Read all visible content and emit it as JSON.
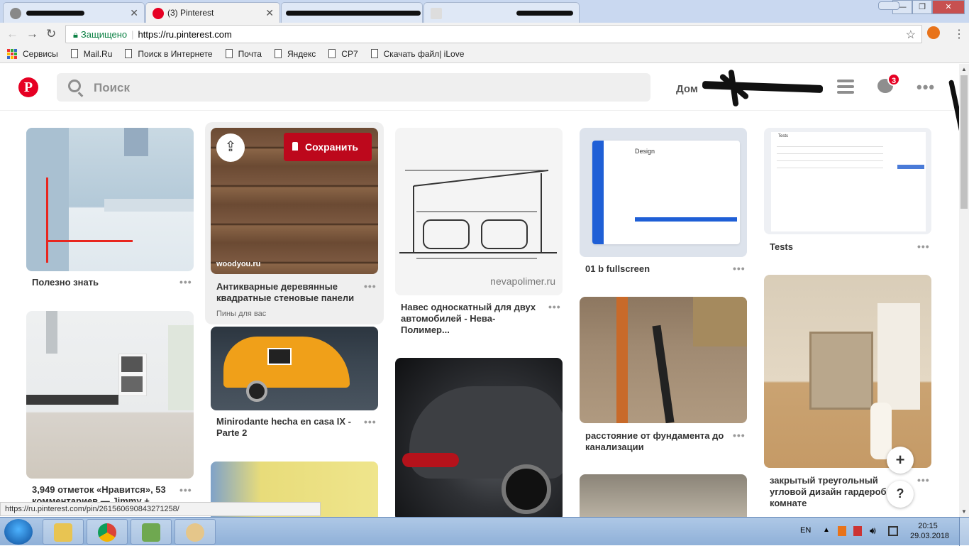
{
  "browser": {
    "tabs": [
      {
        "label": "",
        "redacted": true
      },
      {
        "label": "(3) Pinterest",
        "active": true
      },
      {
        "label": "",
        "redacted": true
      },
      {
        "label": "",
        "redacted": true
      }
    ],
    "secure_label": "Защищено",
    "url": "https://ru.pinterest.com",
    "bookmarks": [
      "Сервисы",
      "Mail.Ru",
      "Поиск в Интернете",
      "Почта",
      "Яндекс",
      "СР7",
      "Скачать файл| iLove"
    ]
  },
  "pinterest": {
    "logo": "P",
    "search_placeholder": "Поиск",
    "home_label": "Дом",
    "notification_count": "3",
    "more": "•••",
    "brand_color": "#e60023"
  },
  "pins": {
    "col1": [
      {
        "title": "Полезно знать"
      },
      {
        "title": "3,949 отметок «Нравится», 53 комментариев — Jimmy +"
      }
    ],
    "col2": [
      {
        "title": "Антикварные деревянные квадратные стеновые панели",
        "source": "woodyou.ru",
        "save_label": "Сохранить",
        "subtitle": "Пины для вас"
      },
      {
        "title": "Minirodante hecha en casa IX - Parte 2"
      }
    ],
    "col3": [
      {
        "title": "Навес односкатный для двух автомобилей - Нева-Полимер...",
        "watermark": "nevapolimer.ru"
      },
      {
        "title": ""
      }
    ],
    "col4": [
      {
        "title": "01 b fullscreen",
        "mock_heading": "Design"
      },
      {
        "title": "расстояние от фундамента до канализации"
      }
    ],
    "col5": [
      {
        "title": "Tests",
        "mock_heading": "Tests"
      },
      {
        "title": "закрытый треугольный угловой дизайн гардероб в комнате"
      }
    ],
    "dots": "•••"
  },
  "floating": {
    "add": "+",
    "help": "?"
  },
  "status_url": "https://ru.pinterest.com/pin/261560690843271258/",
  "taskbar": {
    "lang": "EN",
    "time": "20:15",
    "date": "29.03.2018"
  }
}
